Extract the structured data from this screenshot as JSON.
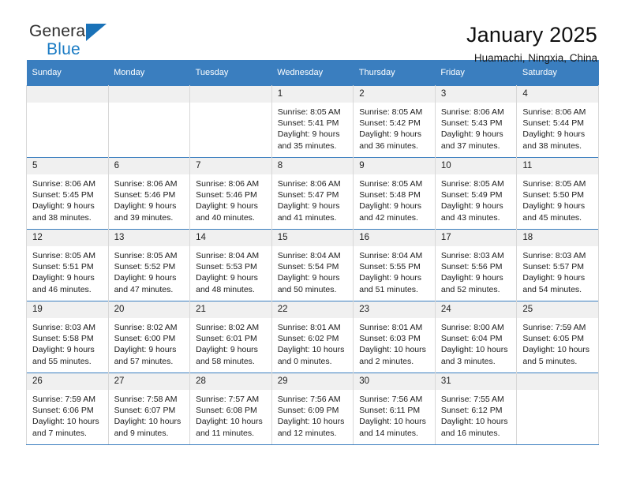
{
  "brand": {
    "name_top": "General",
    "name_bottom": "Blue",
    "accent_color": "#1a7bc4"
  },
  "header": {
    "title": "January 2025",
    "subtitle": "Huamachi, Ningxia, China",
    "header_bg": "#3a7ebf",
    "header_text_color": "#ffffff"
  },
  "weekday_headers": [
    "Sunday",
    "Monday",
    "Tuesday",
    "Wednesday",
    "Thursday",
    "Friday",
    "Saturday"
  ],
  "labels": {
    "sunrise_prefix": "Sunrise:",
    "sunset_prefix": "Sunset:",
    "daylight_prefix": "Daylight:"
  },
  "weeks": [
    [
      {
        "day": "",
        "empty": true
      },
      {
        "day": "",
        "empty": true
      },
      {
        "day": "",
        "empty": true
      },
      {
        "day": "1",
        "sunrise": "Sunrise: 8:05 AM",
        "sunset": "Sunset: 5:41 PM",
        "daylight_line1": "Daylight: 9 hours",
        "daylight_line2": "and 35 minutes."
      },
      {
        "day": "2",
        "sunrise": "Sunrise: 8:05 AM",
        "sunset": "Sunset: 5:42 PM",
        "daylight_line1": "Daylight: 9 hours",
        "daylight_line2": "and 36 minutes."
      },
      {
        "day": "3",
        "sunrise": "Sunrise: 8:06 AM",
        "sunset": "Sunset: 5:43 PM",
        "daylight_line1": "Daylight: 9 hours",
        "daylight_line2": "and 37 minutes."
      },
      {
        "day": "4",
        "sunrise": "Sunrise: 8:06 AM",
        "sunset": "Sunset: 5:44 PM",
        "daylight_line1": "Daylight: 9 hours",
        "daylight_line2": "and 38 minutes."
      }
    ],
    [
      {
        "day": "5",
        "sunrise": "Sunrise: 8:06 AM",
        "sunset": "Sunset: 5:45 PM",
        "daylight_line1": "Daylight: 9 hours",
        "daylight_line2": "and 38 minutes."
      },
      {
        "day": "6",
        "sunrise": "Sunrise: 8:06 AM",
        "sunset": "Sunset: 5:46 PM",
        "daylight_line1": "Daylight: 9 hours",
        "daylight_line2": "and 39 minutes."
      },
      {
        "day": "7",
        "sunrise": "Sunrise: 8:06 AM",
        "sunset": "Sunset: 5:46 PM",
        "daylight_line1": "Daylight: 9 hours",
        "daylight_line2": "and 40 minutes."
      },
      {
        "day": "8",
        "sunrise": "Sunrise: 8:06 AM",
        "sunset": "Sunset: 5:47 PM",
        "daylight_line1": "Daylight: 9 hours",
        "daylight_line2": "and 41 minutes."
      },
      {
        "day": "9",
        "sunrise": "Sunrise: 8:05 AM",
        "sunset": "Sunset: 5:48 PM",
        "daylight_line1": "Daylight: 9 hours",
        "daylight_line2": "and 42 minutes."
      },
      {
        "day": "10",
        "sunrise": "Sunrise: 8:05 AM",
        "sunset": "Sunset: 5:49 PM",
        "daylight_line1": "Daylight: 9 hours",
        "daylight_line2": "and 43 minutes."
      },
      {
        "day": "11",
        "sunrise": "Sunrise: 8:05 AM",
        "sunset": "Sunset: 5:50 PM",
        "daylight_line1": "Daylight: 9 hours",
        "daylight_line2": "and 45 minutes."
      }
    ],
    [
      {
        "day": "12",
        "sunrise": "Sunrise: 8:05 AM",
        "sunset": "Sunset: 5:51 PM",
        "daylight_line1": "Daylight: 9 hours",
        "daylight_line2": "and 46 minutes."
      },
      {
        "day": "13",
        "sunrise": "Sunrise: 8:05 AM",
        "sunset": "Sunset: 5:52 PM",
        "daylight_line1": "Daylight: 9 hours",
        "daylight_line2": "and 47 minutes."
      },
      {
        "day": "14",
        "sunrise": "Sunrise: 8:04 AM",
        "sunset": "Sunset: 5:53 PM",
        "daylight_line1": "Daylight: 9 hours",
        "daylight_line2": "and 48 minutes."
      },
      {
        "day": "15",
        "sunrise": "Sunrise: 8:04 AM",
        "sunset": "Sunset: 5:54 PM",
        "daylight_line1": "Daylight: 9 hours",
        "daylight_line2": "and 50 minutes."
      },
      {
        "day": "16",
        "sunrise": "Sunrise: 8:04 AM",
        "sunset": "Sunset: 5:55 PM",
        "daylight_line1": "Daylight: 9 hours",
        "daylight_line2": "and 51 minutes."
      },
      {
        "day": "17",
        "sunrise": "Sunrise: 8:03 AM",
        "sunset": "Sunset: 5:56 PM",
        "daylight_line1": "Daylight: 9 hours",
        "daylight_line2": "and 52 minutes."
      },
      {
        "day": "18",
        "sunrise": "Sunrise: 8:03 AM",
        "sunset": "Sunset: 5:57 PM",
        "daylight_line1": "Daylight: 9 hours",
        "daylight_line2": "and 54 minutes."
      }
    ],
    [
      {
        "day": "19",
        "sunrise": "Sunrise: 8:03 AM",
        "sunset": "Sunset: 5:58 PM",
        "daylight_line1": "Daylight: 9 hours",
        "daylight_line2": "and 55 minutes."
      },
      {
        "day": "20",
        "sunrise": "Sunrise: 8:02 AM",
        "sunset": "Sunset: 6:00 PM",
        "daylight_line1": "Daylight: 9 hours",
        "daylight_line2": "and 57 minutes."
      },
      {
        "day": "21",
        "sunrise": "Sunrise: 8:02 AM",
        "sunset": "Sunset: 6:01 PM",
        "daylight_line1": "Daylight: 9 hours",
        "daylight_line2": "and 58 minutes."
      },
      {
        "day": "22",
        "sunrise": "Sunrise: 8:01 AM",
        "sunset": "Sunset: 6:02 PM",
        "daylight_line1": "Daylight: 10 hours",
        "daylight_line2": "and 0 minutes."
      },
      {
        "day": "23",
        "sunrise": "Sunrise: 8:01 AM",
        "sunset": "Sunset: 6:03 PM",
        "daylight_line1": "Daylight: 10 hours",
        "daylight_line2": "and 2 minutes."
      },
      {
        "day": "24",
        "sunrise": "Sunrise: 8:00 AM",
        "sunset": "Sunset: 6:04 PM",
        "daylight_line1": "Daylight: 10 hours",
        "daylight_line2": "and 3 minutes."
      },
      {
        "day": "25",
        "sunrise": "Sunrise: 7:59 AM",
        "sunset": "Sunset: 6:05 PM",
        "daylight_line1": "Daylight: 10 hours",
        "daylight_line2": "and 5 minutes."
      }
    ],
    [
      {
        "day": "26",
        "sunrise": "Sunrise: 7:59 AM",
        "sunset": "Sunset: 6:06 PM",
        "daylight_line1": "Daylight: 10 hours",
        "daylight_line2": "and 7 minutes."
      },
      {
        "day": "27",
        "sunrise": "Sunrise: 7:58 AM",
        "sunset": "Sunset: 6:07 PM",
        "daylight_line1": "Daylight: 10 hours",
        "daylight_line2": "and 9 minutes."
      },
      {
        "day": "28",
        "sunrise": "Sunrise: 7:57 AM",
        "sunset": "Sunset: 6:08 PM",
        "daylight_line1": "Daylight: 10 hours",
        "daylight_line2": "and 11 minutes."
      },
      {
        "day": "29",
        "sunrise": "Sunrise: 7:56 AM",
        "sunset": "Sunset: 6:09 PM",
        "daylight_line1": "Daylight: 10 hours",
        "daylight_line2": "and 12 minutes."
      },
      {
        "day": "30",
        "sunrise": "Sunrise: 7:56 AM",
        "sunset": "Sunset: 6:11 PM",
        "daylight_line1": "Daylight: 10 hours",
        "daylight_line2": "and 14 minutes."
      },
      {
        "day": "31",
        "sunrise": "Sunrise: 7:55 AM",
        "sunset": "Sunset: 6:12 PM",
        "daylight_line1": "Daylight: 10 hours",
        "daylight_line2": "and 16 minutes."
      },
      {
        "day": "",
        "empty": true
      }
    ]
  ]
}
